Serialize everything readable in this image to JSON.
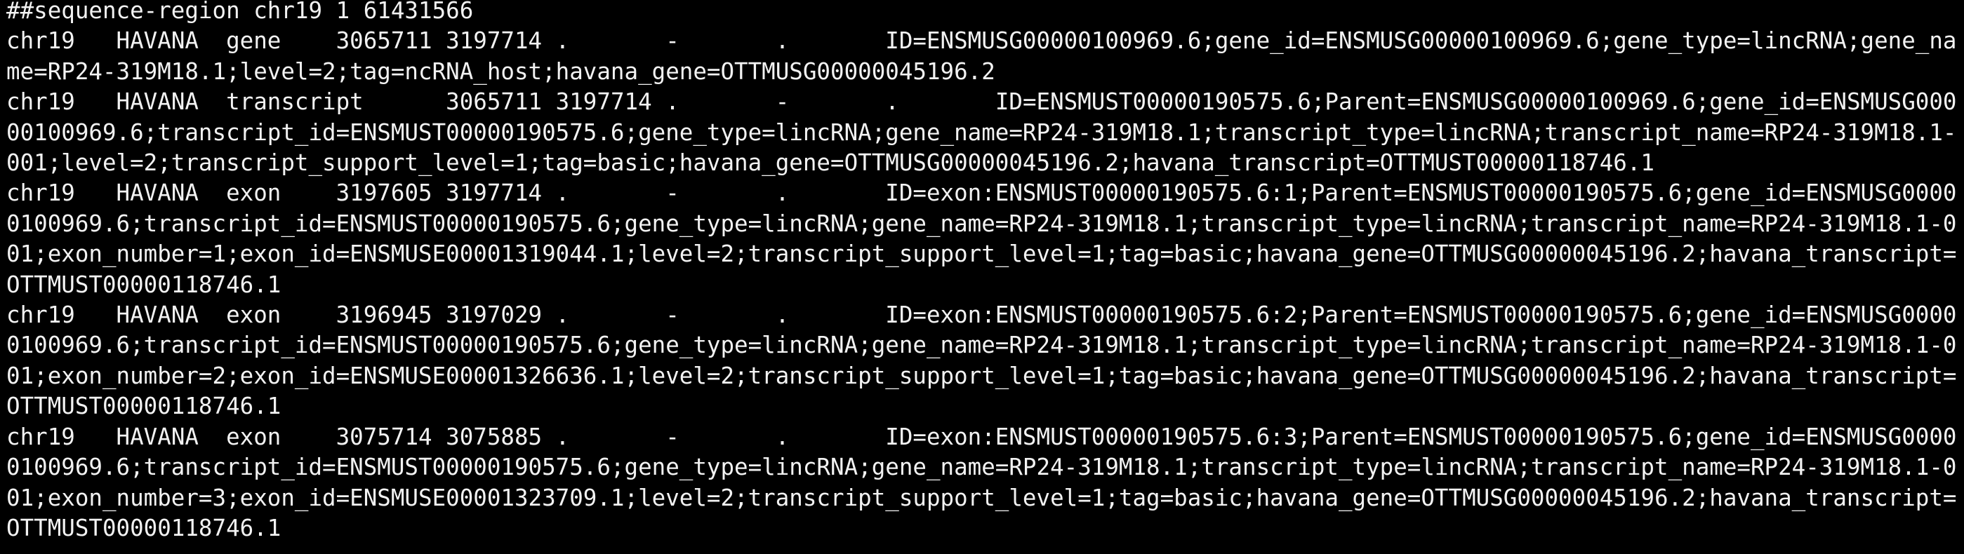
{
  "terminal": {
    "lines": [
      "##sequence-region chr19 1 61431566",
      "chr19\tHAVANA\tgene\t3065711\t3197714\t.\t-\t.\tID=ENSMUSG00000100969.6;gene_id=ENSMUSG00000100969.6;gene_type=lincRNA;gene_name=RP24-319M18.1;level=2;tag=ncRNA_host;havana_gene=OTTMUSG00000045196.2",
      "chr19\tHAVANA\ttranscript\t3065711\t3197714\t.\t-\t.\tID=ENSMUST00000190575.6;Parent=ENSMUSG00000100969.6;gene_id=ENSMUSG00000100969.6;transcript_id=ENSMUST00000190575.6;gene_type=lincRNA;gene_name=RP24-319M18.1;transcript_type=lincRNA;transcript_name=RP24-319M18.1-001;level=2;transcript_support_level=1;tag=basic;havana_gene=OTTMUSG00000045196.2;havana_transcript=OTTMUST00000118746.1",
      "chr19\tHAVANA\texon\t3197605\t3197714\t.\t-\t.\tID=exon:ENSMUST00000190575.6:1;Parent=ENSMUST00000190575.6;gene_id=ENSMUSG00000100969.6;transcript_id=ENSMUST00000190575.6;gene_type=lincRNA;gene_name=RP24-319M18.1;transcript_type=lincRNA;transcript_name=RP24-319M18.1-001;exon_number=1;exon_id=ENSMUSE00001319044.1;level=2;transcript_support_level=1;tag=basic;havana_gene=OTTMUSG00000045196.2;havana_transcript=OTTMUST00000118746.1",
      "chr19\tHAVANA\texon\t3196945\t3197029\t.\t-\t.\tID=exon:ENSMUST00000190575.6:2;Parent=ENSMUST00000190575.6;gene_id=ENSMUSG00000100969.6;transcript_id=ENSMUST00000190575.6;gene_type=lincRNA;gene_name=RP24-319M18.1;transcript_type=lincRNA;transcript_name=RP24-319M18.1-001;exon_number=2;exon_id=ENSMUSE00001326636.1;level=2;transcript_support_level=1;tag=basic;havana_gene=OTTMUSG00000045196.2;havana_transcript=OTTMUST00000118746.1",
      "chr19\tHAVANA\texon\t3075714\t3075885\t.\t-\t.\tID=exon:ENSMUST00000190575.6:3;Parent=ENSMUST00000190575.6;gene_id=ENSMUSG00000100969.6;transcript_id=ENSMUST00000190575.6;gene_type=lincRNA;gene_name=RP24-319M18.1;transcript_type=lincRNA;transcript_name=RP24-319M18.1-001;exon_number=3;exon_id=ENSMUSE00001323709.1;level=2;transcript_support_level=1;tag=basic;havana_gene=OTTMUSG00000045196.2;havana_transcript=OTTMUST00000118746.1"
    ]
  }
}
